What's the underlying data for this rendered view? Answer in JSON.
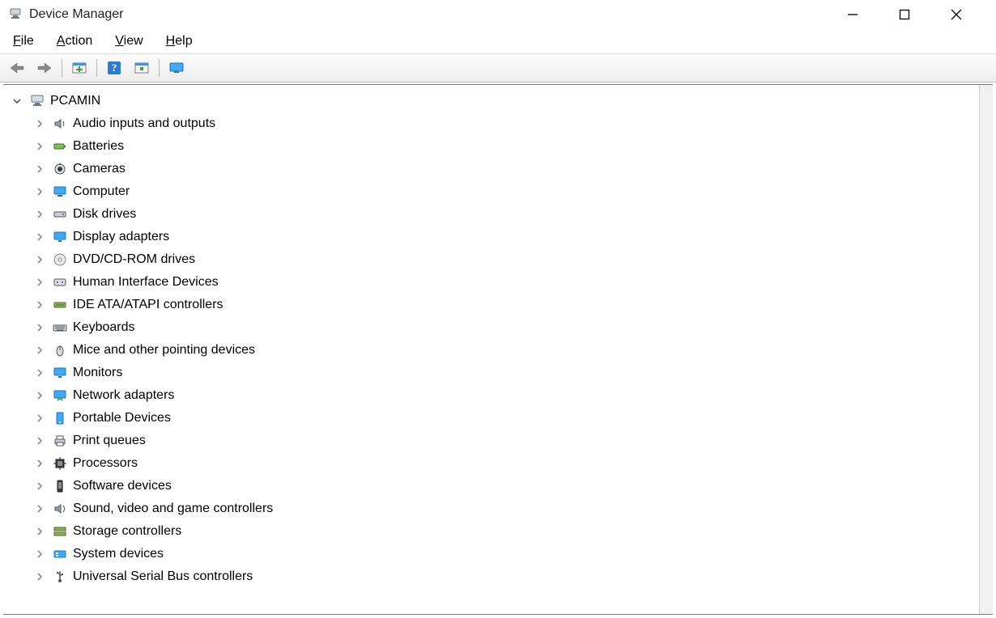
{
  "window": {
    "title": "Device Manager"
  },
  "menu": {
    "file": "File",
    "action": "Action",
    "view": "View",
    "help": "Help"
  },
  "tree": {
    "root": "PCAMIN",
    "items": [
      {
        "icon": "audio",
        "label": "Audio inputs and outputs"
      },
      {
        "icon": "battery",
        "label": "Batteries"
      },
      {
        "icon": "camera",
        "label": "Cameras"
      },
      {
        "icon": "computer",
        "label": "Computer"
      },
      {
        "icon": "disk",
        "label": "Disk drives"
      },
      {
        "icon": "display",
        "label": "Display adapters"
      },
      {
        "icon": "dvd",
        "label": "DVD/CD-ROM drives"
      },
      {
        "icon": "hid",
        "label": "Human Interface Devices"
      },
      {
        "icon": "ide",
        "label": "IDE ATA/ATAPI controllers"
      },
      {
        "icon": "keyboard",
        "label": "Keyboards"
      },
      {
        "icon": "mouse",
        "label": "Mice and other pointing devices"
      },
      {
        "icon": "monitor",
        "label": "Monitors"
      },
      {
        "icon": "network",
        "label": "Network adapters"
      },
      {
        "icon": "portable",
        "label": "Portable Devices"
      },
      {
        "icon": "printer",
        "label": "Print queues"
      },
      {
        "icon": "cpu",
        "label": "Processors"
      },
      {
        "icon": "software",
        "label": "Software devices"
      },
      {
        "icon": "sound",
        "label": "Sound, video and game controllers"
      },
      {
        "icon": "storage",
        "label": "Storage controllers"
      },
      {
        "icon": "system",
        "label": "System devices"
      },
      {
        "icon": "usb",
        "label": "Universal Serial Bus controllers"
      }
    ]
  }
}
